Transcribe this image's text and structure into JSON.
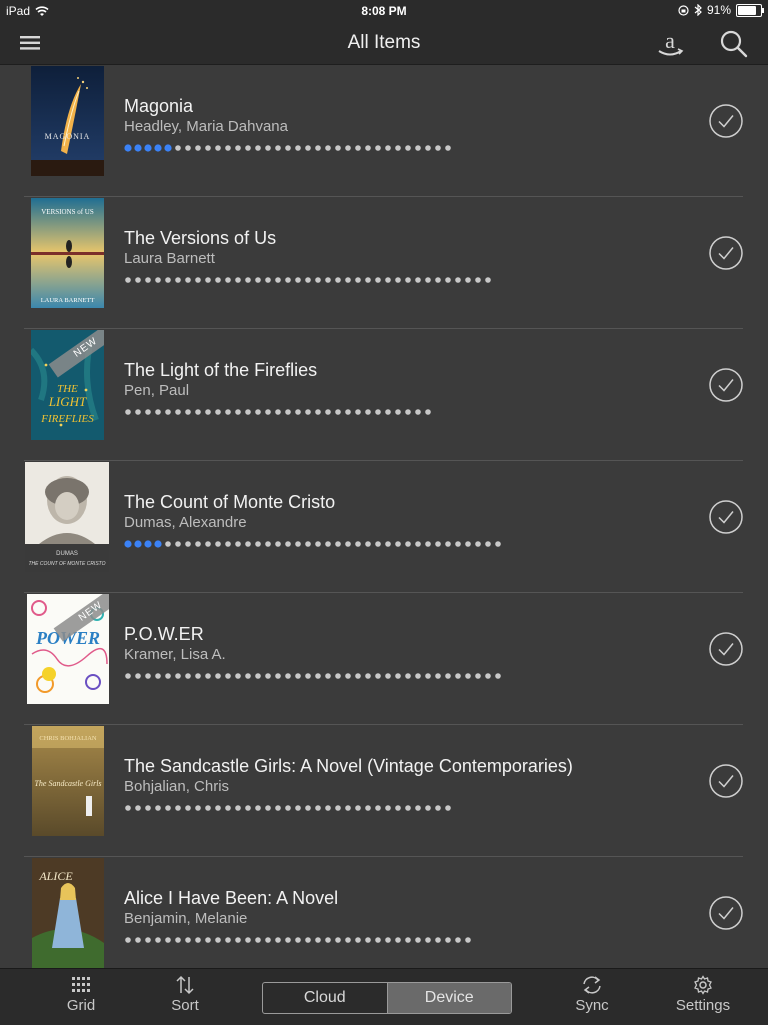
{
  "status_bar": {
    "device": "iPad",
    "time": "8:08 PM",
    "battery": "91%",
    "battery_level": 0.91
  },
  "nav": {
    "title": "All Items"
  },
  "books": [
    {
      "title": "Magonia",
      "author": "Headley, Maria Dahvana",
      "dots_read": 5,
      "dots_total": 33,
      "is_new": false,
      "cover_text": "MAGONIA"
    },
    {
      "title": "The Versions of Us",
      "author": "Laura Barnett",
      "dots_read": 0,
      "dots_total": 37,
      "is_new": false,
      "cover_text": "VERSIONS of US",
      "cover_text2": "LAURA BARNETT"
    },
    {
      "title": "The Light of the Fireflies",
      "author": "Pen, Paul",
      "dots_read": 0,
      "dots_total": 31,
      "is_new": true,
      "cover_text": "THE LIGHT OF THE FIREFLIES"
    },
    {
      "title": "The Count of Monte Cristo",
      "author": "Dumas, Alexandre",
      "dots_read": 4,
      "dots_total": 38,
      "is_new": false,
      "cover_text": "DUMAS",
      "cover_text2": "THE COUNT OF MONTE CRISTO"
    },
    {
      "title": "P.O.W.ER",
      "author": "Kramer, Lisa A.",
      "dots_read": 0,
      "dots_total": 38,
      "is_new": true,
      "cover_text": "POWER"
    },
    {
      "title": "The Sandcastle Girls: A Novel (Vintage Contemporaries)",
      "author": "Bohjalian, Chris",
      "dots_read": 0,
      "dots_total": 33,
      "is_new": false,
      "cover_text": "CHRIS BOHJALIAN",
      "cover_text2": "The Sandcastle Girls"
    },
    {
      "title": "Alice I Have Been: A Novel",
      "author": "Benjamin, Melanie",
      "dots_read": 0,
      "dots_total": 35,
      "is_new": false,
      "cover_text": "ALICE"
    }
  ],
  "new_badge": "NEW",
  "tabbar": {
    "grid": "Grid",
    "sort": "Sort",
    "segment": {
      "cloud": "Cloud",
      "device": "Device",
      "selected": "Device"
    },
    "sync": "Sync",
    "settings": "Settings"
  },
  "colors": {
    "progress_read": "#3b82f6",
    "progress_unread": "#c8c8c8"
  }
}
